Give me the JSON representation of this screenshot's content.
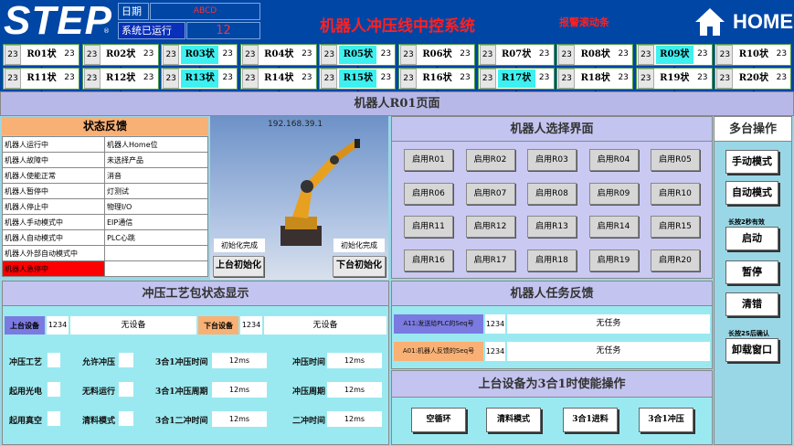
{
  "header": {
    "logo": "STEP",
    "reg": "®",
    "date_label": "日期",
    "date_value": "ABCD",
    "run_label": "系统已运行",
    "run_value": "12",
    "title": "机器人冲压线中控系统",
    "alarm": "报警滚动条",
    "home": "HOME"
  },
  "status_cells": [
    {
      "n": "23",
      "label": "R01状态",
      "v": "23",
      "c": "#ffffff"
    },
    {
      "n": "23",
      "label": "R02状态",
      "v": "23",
      "c": "#ffffff"
    },
    {
      "n": "23",
      "label": "R03状态",
      "v": "23",
      "c": "#3ef0f0"
    },
    {
      "n": "23",
      "label": "R04状态",
      "v": "23",
      "c": "#ffffff"
    },
    {
      "n": "23",
      "label": "R05状态",
      "v": "23",
      "c": "#3ef0f0"
    },
    {
      "n": "23",
      "label": "R06状态",
      "v": "23",
      "c": "#ffffff"
    },
    {
      "n": "23",
      "label": "R07状态",
      "v": "23",
      "c": "#ffffff"
    },
    {
      "n": "23",
      "label": "R08状态",
      "v": "23",
      "c": "#ffffff"
    },
    {
      "n": "23",
      "label": "R09状态",
      "v": "23",
      "c": "#3ef0f0"
    },
    {
      "n": "23",
      "label": "R10状态",
      "v": "23",
      "c": "#ffffff"
    },
    {
      "n": "23",
      "label": "R11状态",
      "v": "23",
      "c": "#ffffff"
    },
    {
      "n": "23",
      "label": "R12状态",
      "v": "23",
      "c": "#ffffff"
    },
    {
      "n": "23",
      "label": "R13状态",
      "v": "23",
      "c": "#3ef0f0"
    },
    {
      "n": "23",
      "label": "R14状态",
      "v": "23",
      "c": "#ffffff"
    },
    {
      "n": "23",
      "label": "R15状态",
      "v": "23",
      "c": "#3ef0f0"
    },
    {
      "n": "23",
      "label": "R16状态",
      "v": "23",
      "c": "#ffffff"
    },
    {
      "n": "23",
      "label": "R17状态",
      "v": "23",
      "c": "#3ef0f0"
    },
    {
      "n": "23",
      "label": "R18状态",
      "v": "23",
      "c": "#ffffff"
    },
    {
      "n": "23",
      "label": "R19状态",
      "v": "23",
      "c": "#ffffff"
    },
    {
      "n": "23",
      "label": "R20状态",
      "v": "23",
      "c": "#ffffff"
    }
  ],
  "page_title": "机器人R01页面",
  "status_feedback": {
    "title": "状态反馈",
    "rows": [
      [
        "机器人运行中",
        "机器人Home位"
      ],
      [
        "机器人故障中",
        "未选择产品"
      ],
      [
        "机器人使能正常",
        "消音"
      ],
      [
        "机器人暂停中",
        "灯测试"
      ],
      [
        "机器人停止中",
        "物理I/O"
      ],
      [
        "机器人手动模式中",
        "EIP通信"
      ],
      [
        "机器人自动模式中",
        "PLC心跳"
      ],
      [
        "机器人外部自动模式中",
        ""
      ],
      [
        "机器人急停中",
        ""
      ]
    ]
  },
  "robot_view": {
    "ip": "192.168.39.1",
    "init_left_status": "初始化完成",
    "init_right_status": "初始化完成",
    "init_left_button": "上台初始化",
    "init_right_button": "下台初始化"
  },
  "robot_select": {
    "title": "机器人选择界面",
    "buttons": [
      "启用R01",
      "启用R02",
      "启用R03",
      "启用R04",
      "启用R05",
      "启用R06",
      "启用R07",
      "启用R08",
      "启用R09",
      "启用R10",
      "启用R11",
      "启用R12",
      "启用R13",
      "启用R14",
      "启用R15",
      "启用R16",
      "启用R17",
      "启用R18",
      "启用R19",
      "启用R20"
    ]
  },
  "multi": {
    "title": "多台操作",
    "manual": "手动模式",
    "auto": "自动模式",
    "hold_note": "长按2秒有效",
    "start": "启动",
    "pause": "暂停",
    "clear": "清错",
    "confirm_note": "长按2S后确认",
    "unload": "卸载窗口"
  },
  "press": {
    "title": "冲压工艺包状态显示",
    "upper_label": "上台设备",
    "upper_num": "1234",
    "upper_val": "无设备",
    "lower_label": "下台设备",
    "lower_num": "1234",
    "lower_val": "无设备",
    "r1": [
      "冲压工艺",
      "允许冲压",
      "3合1冲压时间",
      "12ms",
      "冲压时间",
      "12ms"
    ],
    "r2": [
      "起用光电",
      "无料运行",
      "3合1冲压周期",
      "12ms",
      "冲压周期",
      "12ms"
    ],
    "r3": [
      "起用真空",
      "清料模式",
      "3合1二冲时间",
      "12ms",
      "二冲时间",
      "12ms"
    ]
  },
  "task": {
    "title": "机器人任务反馈",
    "a_label": "A11:发送给PLC的Seq号",
    "a_num": "1234",
    "a_val": "无任务",
    "b_label": "A01:机器人反馈的Seq号",
    "b_num": "1234",
    "b_val": "无任务"
  },
  "combo": {
    "title": "上台设备为3合1时使能操作",
    "b1": "空循环",
    "b2": "清料模式",
    "b3": "3合1进料",
    "b4": "3合1冲压"
  },
  "colors": {
    "header": "#0046a5",
    "cyan": "#3ef0f0",
    "estop": "#ff0000"
  }
}
